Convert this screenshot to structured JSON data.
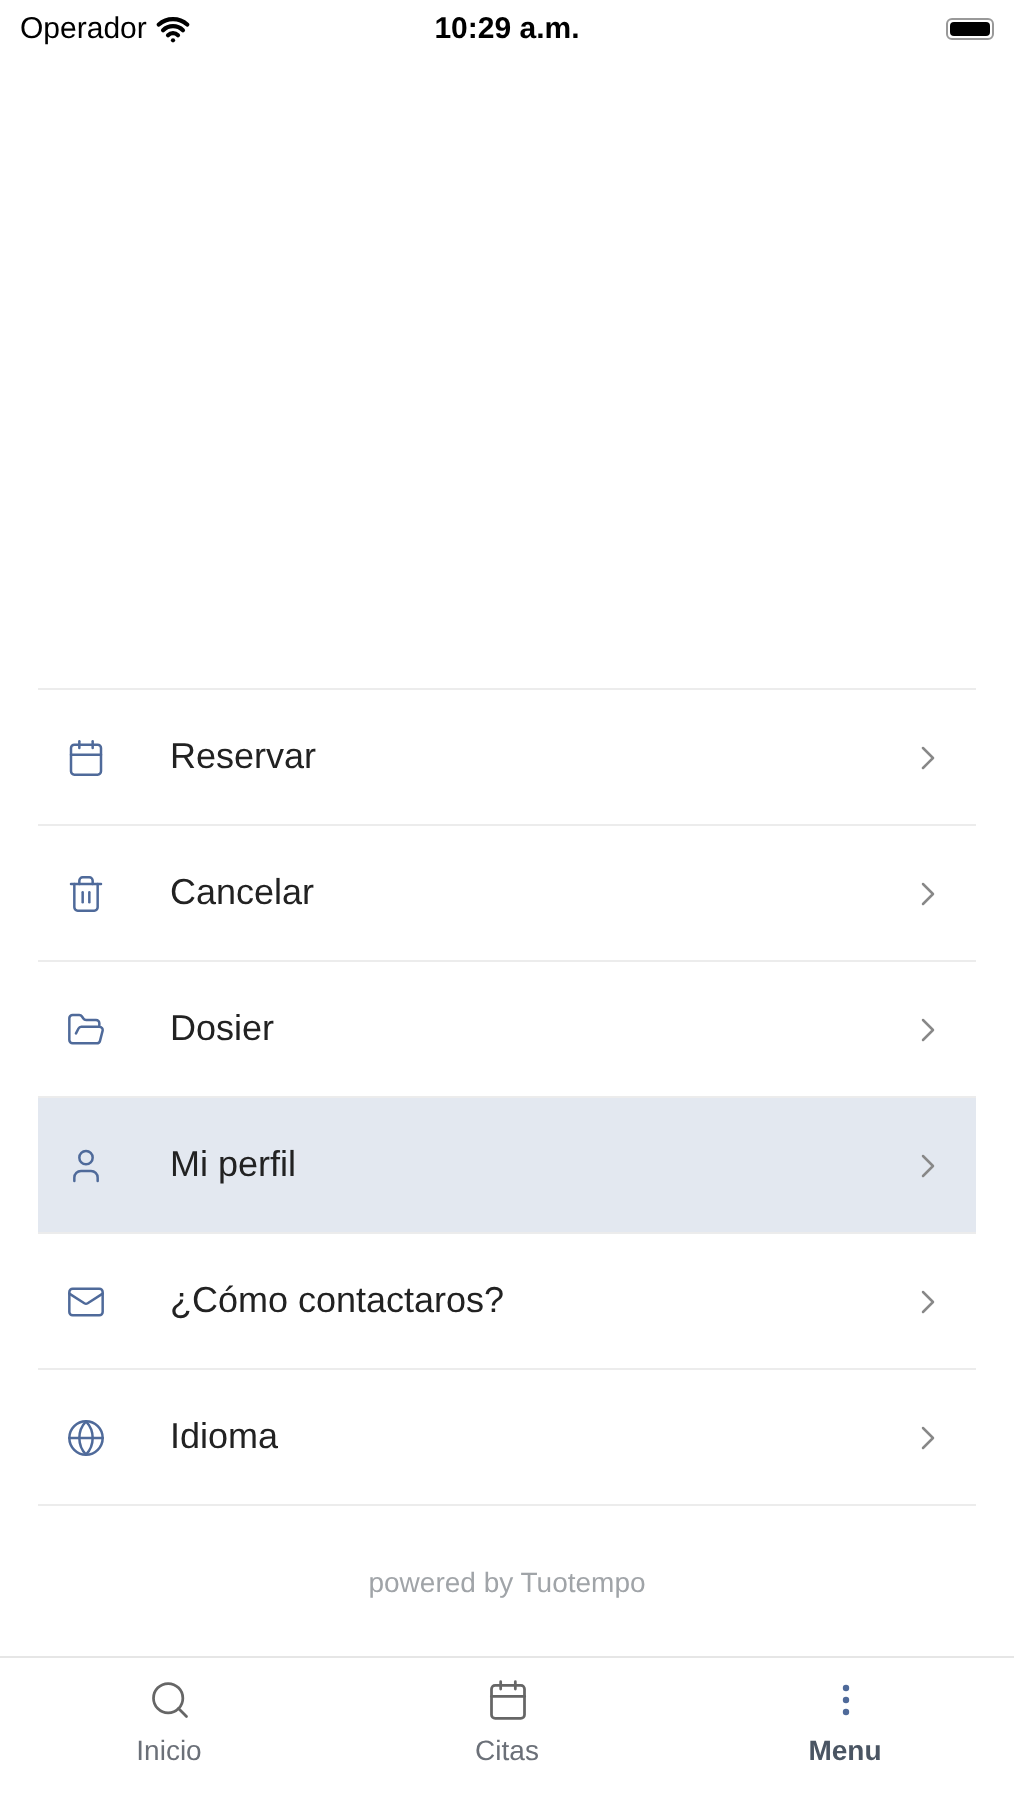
{
  "status_bar": {
    "carrier": "Operador",
    "time": "10:29 a.m."
  },
  "menu": {
    "items": [
      {
        "label": "Reservar",
        "selected": false
      },
      {
        "label": "Cancelar",
        "selected": false
      },
      {
        "label": "Dosier",
        "selected": false
      },
      {
        "label": "Mi perfil",
        "selected": true
      },
      {
        "label": "¿Cómo contactaros?",
        "selected": false
      },
      {
        "label": "Idioma",
        "selected": false
      }
    ]
  },
  "footer": "powered by Tuotempo",
  "tab_bar": [
    {
      "label": "Inicio",
      "selected": false
    },
    {
      "label": "Citas",
      "selected": false
    },
    {
      "label": "Menu",
      "selected": true
    }
  ]
}
